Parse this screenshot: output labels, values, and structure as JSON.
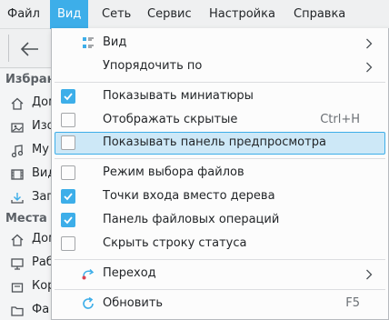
{
  "menubar": {
    "items": [
      {
        "label": "Файл",
        "active": false
      },
      {
        "label": "Вид",
        "active": true
      },
      {
        "label": "Сеть",
        "active": false
      },
      {
        "label": "Сервис",
        "active": false
      },
      {
        "label": "Настройка",
        "active": false
      },
      {
        "label": "Справка",
        "active": false
      }
    ]
  },
  "sidebar": {
    "places_header": "Избранное",
    "places_header_visible": "Избран",
    "favorites": [
      {
        "label": "Дом",
        "icon": "home-icon"
      },
      {
        "label": "Изо",
        "icon": "image-folder-icon"
      },
      {
        "label": "Му",
        "icon": "music-icon"
      },
      {
        "label": "Вид",
        "icon": "video-icon"
      },
      {
        "label": "Заг",
        "icon": "download-icon"
      }
    ],
    "section2_header": "Места",
    "places": [
      {
        "label": "Дом",
        "icon": "home-icon"
      },
      {
        "label": "Раб",
        "icon": "desktop-icon"
      },
      {
        "label": "Кор",
        "icon": "trash-icon"
      },
      {
        "label": "Фа",
        "icon": "folder-icon"
      }
    ]
  },
  "view_menu": {
    "items": [
      {
        "label": "Вид",
        "icon": "view-mode-icon",
        "submenu": true
      },
      {
        "label": "Упорядочить по",
        "submenu": true
      },
      {
        "label": "Показывать миниатюры",
        "checkbox": true,
        "checked": true
      },
      {
        "label": "Отображать скрытые",
        "checkbox": true,
        "checked": false,
        "shortcut": "Ctrl+H"
      },
      {
        "label": "Показывать панель предпросмотра",
        "checkbox": true,
        "checked": false,
        "highlighted": true
      },
      {
        "label": "Режим выбора файлов",
        "checkbox": true,
        "checked": false
      },
      {
        "label": "Точки входа вместо дерева",
        "checkbox": true,
        "checked": true
      },
      {
        "label": "Панель файловых операций",
        "checkbox": true,
        "checked": true
      },
      {
        "label": "Скрыть строку статуса",
        "checkbox": true,
        "checked": false
      },
      {
        "label": "Переход",
        "icon": "go-jump-icon",
        "submenu": true
      },
      {
        "label": "Обновить",
        "icon": "refresh-icon",
        "shortcut": "F5"
      }
    ]
  },
  "colors": {
    "accent": "#3daee9",
    "highlight_bg": "#cde8f7",
    "menu_bg": "#fcfcfc"
  }
}
